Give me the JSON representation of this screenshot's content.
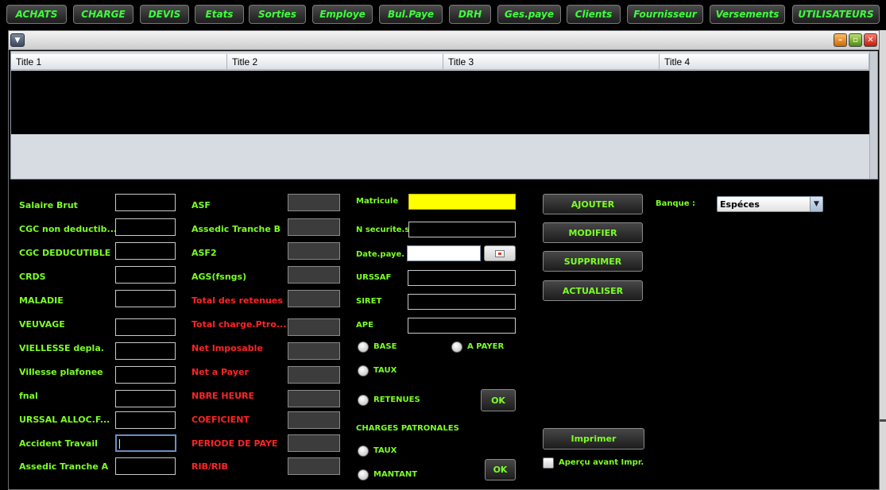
{
  "menu": [
    "ACHATS",
    "CHARGE",
    "DEVIS",
    "Etats",
    "Sorties",
    "Employe",
    "Bul.Paye",
    "DRH",
    "Ges.paye",
    "Clients",
    "Fournisseur",
    "Versements",
    "UTILISATEURS"
  ],
  "window": {
    "sysmenu_icon": "triangle-down-icon",
    "minimize_icon": "minimize-icon",
    "maximize_icon": "restore-icon",
    "close_icon": "close-icon",
    "close_glyph": "✕"
  },
  "table": {
    "columns": [
      "Title 1",
      "Title 2",
      "Title 3",
      "Title 4"
    ],
    "rows": []
  },
  "form": {
    "col1": [
      "Salaire Brut",
      "CGC non deductib...",
      "CGC DEDUCUTIBLE",
      "CRDS",
      "MALADIE",
      "VEUVAGE",
      "VIELLESSE depla.",
      "Villesse plafonee",
      "fnal",
      "URSSAL ALLOC.F...",
      "Accident Travail",
      "Assedic Tranche A"
    ],
    "col2": [
      "ASF",
      "Assedic Tranche B",
      "ASF2",
      "AGS(fsngs)",
      "Total des retenues",
      "Total charge.Ptro...",
      "Net Imposable",
      "Net a Payer",
      "NBRE HEURE",
      "COEFICIENT",
      "PERIODE DE PAYE",
      "RIB/RIB"
    ],
    "col3": [
      "Matricule",
      "N securite.s",
      "Date.paye.",
      "URSSAF",
      "SIRET",
      "APE"
    ],
    "radios": {
      "base": "BASE",
      "a_payer": "A PAYER",
      "taux": "TAUX",
      "retenues": "RETENUES",
      "taux2": "TAUX",
      "mantant": "MANTANT"
    },
    "charges_patronales": "CHARGES PATRONALES",
    "ok": "OK"
  },
  "actions": {
    "ajouter": "AJOUTER",
    "modifier": "MODIFIER",
    "supprimer": "SUPPRIMER",
    "actualiser": "ACTUALISER",
    "imprimer": "Imprimer",
    "apercu": "Aperçu avant Impr."
  },
  "banque": {
    "label": "Banque :",
    "value": "Espéces"
  },
  "colors": {
    "label_green": "#7cff26",
    "label_red": "#ff2424",
    "menu_text": "#3cff3c",
    "matricule_bg": "#ffff00"
  }
}
